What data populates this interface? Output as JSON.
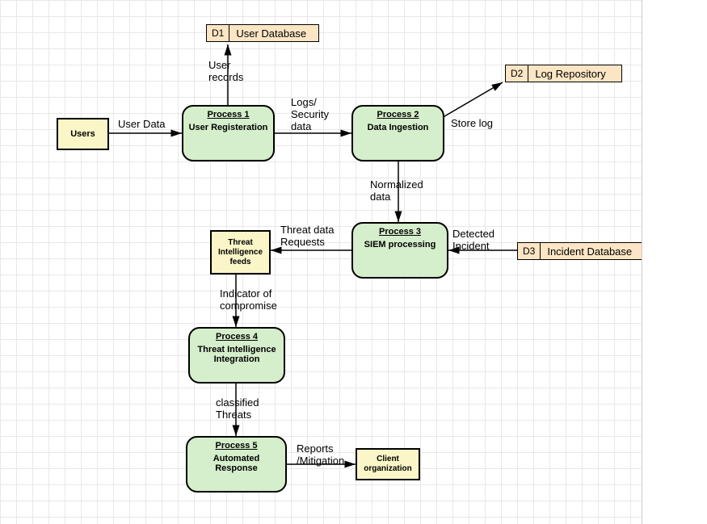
{
  "entities": {
    "users": "Users",
    "threat_intel": "Threat Intelligence feeds",
    "client_org": "Client organization"
  },
  "processes": {
    "p1": {
      "title": "Process 1",
      "name": "User Registeration"
    },
    "p2": {
      "title": "Process 2",
      "name": "Data Ingestion"
    },
    "p3": {
      "title": "Process 3",
      "name": "SIEM processing"
    },
    "p4": {
      "title": "Process 4",
      "name": "Threat Intelligence Integration"
    },
    "p5": {
      "title": "Process 5",
      "name": "Automated Response"
    }
  },
  "datastores": {
    "d1": {
      "id": "D1",
      "name": "User Database"
    },
    "d2": {
      "id": "D2",
      "name": "Log Repository"
    },
    "d3": {
      "id": "D3",
      "name": "Incident Database"
    }
  },
  "flows": {
    "user_data": "User Data",
    "user_records": "User\nrecords",
    "logs_sec": "Logs/\nSecurity\ndata",
    "store_log": "Store log",
    "normalized": "Normalized\ndata",
    "threat_req": "Threat data\nRequests",
    "detected": "Detected\nIncident",
    "ioc": "Indicator of\ncompromise",
    "classified": "classified\nThreats",
    "reports": "Reports\n/Mitigation"
  }
}
